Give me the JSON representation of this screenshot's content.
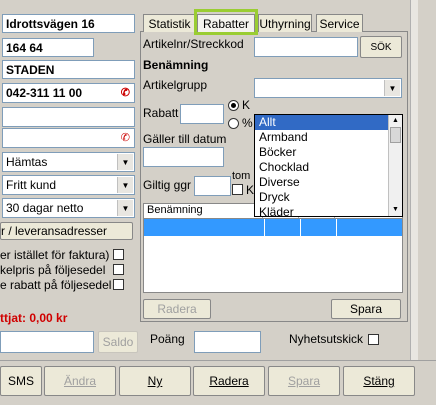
{
  "customer": {
    "address": "Idrottsvägen 16",
    "zip": "164 64",
    "city": "STADEN",
    "phone": "042-311 11 00",
    "delivery": "Hämtas",
    "customer_type": "Fritt kund",
    "payment_terms": "30 dagar netto",
    "addresses_button": "r / leveransadresser",
    "option_1": "er istället för faktura)",
    "option_2": "kelpris på följesedel",
    "option_3": "e rabatt på följesedel",
    "debt_label": "ttjat: 0,00 kr",
    "saldo_button": "Saldo",
    "points_label": "Poäng",
    "newsletter_label": "Nyhetsutskick"
  },
  "tabs": [
    "Statistik",
    "Rabatter",
    "Uthyrning",
    "Service"
  ],
  "active_tab": "Rabatter",
  "discount_panel": {
    "article_label": "Artikelnr/Streckkod",
    "search_button": "SÖK",
    "name_label": "Benämning",
    "group_label": "Artikelgrupp",
    "discount_label": "Rabatt",
    "radio_kr": "K",
    "radio_pct": "%",
    "valid_label": "Gäller till datum",
    "times_label": "Giltig ggr",
    "empty_label": "tom",
    "checkbox_k": "K",
    "table_header": "Benämning",
    "delete_button": "Radera",
    "save_button": "Spara"
  },
  "group_dropdown": {
    "options": [
      "Allt",
      "Armband",
      "Böcker",
      "Chocklad",
      "Diverse",
      "Dryck",
      "Kläder"
    ],
    "selected": "Allt"
  },
  "bottom_bar": {
    "sms": "SMS",
    "edit": "Ändra",
    "new": "Ny",
    "delete": "Radera",
    "save": "Spara",
    "close": "Stäng"
  },
  "colors": {
    "tab_highlight": "#9acd32",
    "debt_text": "#d00000",
    "selection": "#316ac5",
    "table_row": "#3399ff"
  }
}
